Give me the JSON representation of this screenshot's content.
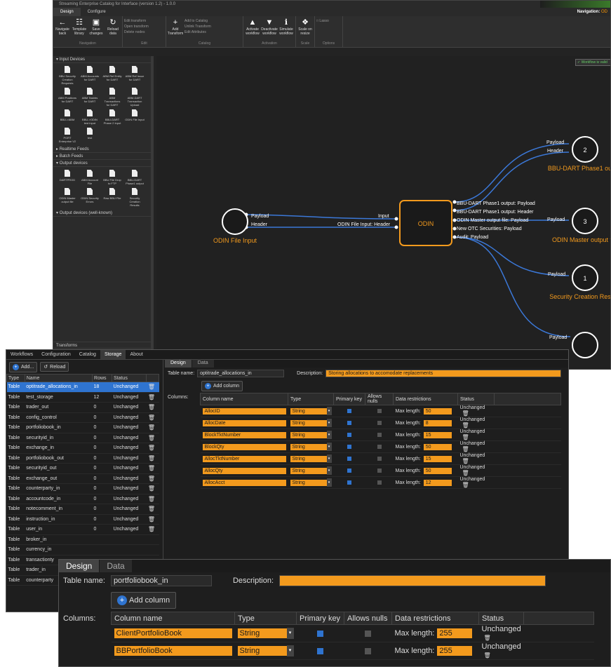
{
  "win1": {
    "title": "Streaming Enterprise Catalog for Interface (version 1.2) - 1.0.0",
    "tabs": [
      "Design",
      "Configure"
    ],
    "navigation": {
      "label": "Navigation:",
      "value": "OD"
    },
    "status": "Production",
    "ribbon": {
      "navigation": {
        "label": "Navigation",
        "items": [
          "Navigate back",
          "Template library",
          "Save changes",
          "Reload data"
        ]
      },
      "edit": {
        "label": "Edit",
        "items": [
          "Edit transform",
          "Open transform",
          "Delete nodes"
        ]
      },
      "catalog": {
        "label": "Catalog",
        "add": "Add Transform",
        "items": [
          "Add to Catalog",
          "Unlink Transform",
          "Edit Attributes"
        ]
      },
      "activation": {
        "label": "Activation",
        "items": [
          "Activate workflow",
          "Deactivate workflow",
          "Simulate workflow"
        ]
      },
      "scale": {
        "label": "Scale",
        "items": [
          "Scale on resize"
        ]
      },
      "options": {
        "label": "Options",
        "items": [
          "Lasso"
        ]
      }
    },
    "panel": {
      "input_devices_label": "Input Devices",
      "input_devices": [
        "BBU Security Creation Requests",
        "ABM Accounts for DART",
        "ABM Ref Entity for DART",
        "ABM Ref Issue for DART",
        "ABM Positions for DART",
        "ABM Tasbtrs for DART",
        "ABM Transactions for DART",
        "ABM-DART Transaction Upload",
        "BBU->ABM",
        "BBU->ODIN test input",
        "BBU-DART Phase 2 Input",
        "ODIN File Input",
        "PORT Enterprise V2",
        "test"
      ],
      "realtime_label": "Realtime Feeds",
      "batch_label": "Batch Feeds",
      "output_label": "Output devices",
      "output_devices": [
        "DARTPROD",
        "ABM Account File",
        "BBU File Drop to FTP",
        "BBU-DART Phase1 output",
        "ODIN Master output file",
        "ODIN Security Errors",
        "Raw BBU File",
        "Security Creation Results"
      ],
      "wellknown_label": "Output devices (well-known)",
      "transforms_label": "Transforms"
    },
    "canvas": {
      "valid": "Workflow is valid",
      "input_node": "ODIN File Input",
      "payload": "Payload",
      "header": "Header",
      "input_port": "Input",
      "odin_header": "ODIN File Input: Header",
      "transform": "ODIN",
      "outputs": [
        "BBU-DART Phase1 output: Payload",
        "BBU-DART Phase1 output: Header",
        "ODIN Master output file: Payload",
        "New OTC Securities: Payload",
        "Audit: Payload"
      ],
      "out_nodes": [
        {
          "num": "2",
          "label": "BBU-DART Phase1 output"
        },
        {
          "num": "3",
          "label": "ODIN Master output file"
        },
        {
          "num": "1",
          "label": "Security Creation Results"
        }
      ]
    }
  },
  "win2": {
    "tabs": [
      "Workflows",
      "Configuration",
      "Catalog",
      "Storage",
      "About"
    ],
    "add": "Add...",
    "reload": "Reload",
    "headers": [
      "Type",
      "Name",
      "Rows",
      "Status"
    ],
    "rows": [
      [
        "Table",
        "optitrade_allocations_in",
        "18",
        "Unchanged"
      ],
      [
        "Table",
        "test_storage",
        "12",
        "Unchanged"
      ],
      [
        "Table",
        "trader_out",
        "0",
        "Unchanged"
      ],
      [
        "Table",
        "config_control",
        "0",
        "Unchanged"
      ],
      [
        "Table",
        "portfoliobook_in",
        "0",
        "Unchanged"
      ],
      [
        "Table",
        "securityid_in",
        "0",
        "Unchanged"
      ],
      [
        "Table",
        "exchange_in",
        "0",
        "Unchanged"
      ],
      [
        "Table",
        "portfoliobook_out",
        "0",
        "Unchanged"
      ],
      [
        "Table",
        "securityid_out",
        "0",
        "Unchanged"
      ],
      [
        "Table",
        "exchange_out",
        "0",
        "Unchanged"
      ],
      [
        "Table",
        "counterparty_in",
        "0",
        "Unchanged"
      ],
      [
        "Table",
        "accountcode_in",
        "0",
        "Unchanged"
      ],
      [
        "Table",
        "notecomment_in",
        "0",
        "Unchanged"
      ],
      [
        "Table",
        "instruction_in",
        "0",
        "Unchanged"
      ],
      [
        "Table",
        "user_in",
        "0",
        "Unchanged"
      ],
      [
        "Table",
        "broker_in",
        "",
        ""
      ],
      [
        "Table",
        "currency_in",
        "",
        ""
      ],
      [
        "Table",
        "transactionty",
        "",
        ""
      ],
      [
        "Table",
        "trader_in",
        "",
        ""
      ],
      [
        "Table",
        "counterparty",
        "",
        ""
      ]
    ],
    "subtabs": [
      "Design",
      "Data"
    ],
    "table_name_label": "Table name:",
    "table_name": "optitrade_allocations_in",
    "desc_label": "Description:",
    "desc": "Storing allocations to accomodate replacements",
    "add_column": "Add column",
    "columns_label": "Columns:",
    "col_headers": [
      "Column name",
      "Type",
      "Primary key",
      "Allows nulls",
      "Data restrictions",
      "Status"
    ],
    "max_label": "Max length:",
    "columns": [
      {
        "name": "AllocID",
        "type": "String",
        "max": "50",
        "status": "Unchanged"
      },
      {
        "name": "AllocDate",
        "type": "String",
        "max": "8",
        "status": "Unchanged"
      },
      {
        "name": "BlockTktNumber",
        "type": "String",
        "max": "15",
        "status": "Unchanged"
      },
      {
        "name": "BlockQty",
        "type": "String",
        "max": "50",
        "status": "Unchanged"
      },
      {
        "name": "AllocTktNumber",
        "type": "String",
        "max": "15",
        "status": "Unchanged"
      },
      {
        "name": "AllocQty",
        "type": "String",
        "max": "50",
        "status": "Unchanged"
      },
      {
        "name": "AllocAcct",
        "type": "String",
        "max": "12",
        "status": "Unchanged"
      }
    ]
  },
  "win3": {
    "subtabs": [
      "Design",
      "Data"
    ],
    "table_name_label": "Table name:",
    "table_name": "portfoliobook_in",
    "desc_label": "Description:",
    "add_column": "Add column",
    "columns_label": "Columns:",
    "col_headers": [
      "Column name",
      "Type",
      "Primary key",
      "Allows nulls",
      "Data restrictions",
      "Status"
    ],
    "max_label": "Max length:",
    "columns": [
      {
        "name": "ClientPortfolioBook",
        "type": "String",
        "max": "255",
        "status": "Unchanged"
      },
      {
        "name": "BBPortfolioBook",
        "type": "String",
        "max": "255",
        "status": "Unchanged"
      }
    ]
  }
}
